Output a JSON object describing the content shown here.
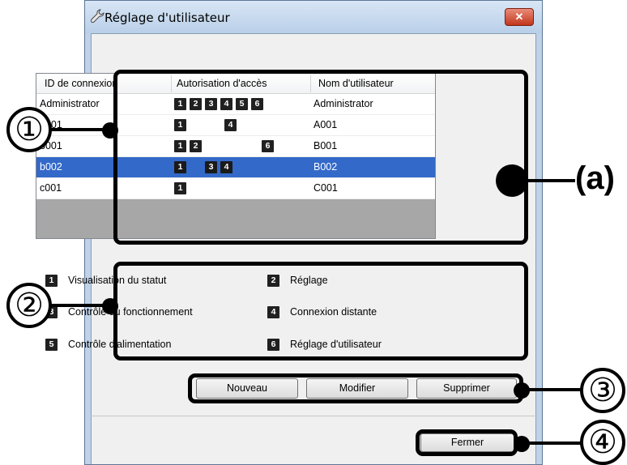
{
  "window": {
    "title": "Réglage d'utilisateur",
    "close_glyph": "✕"
  },
  "table": {
    "headers": [
      "ID de connexion",
      "Autorisation d'accès",
      "Nom d'utilisateur"
    ],
    "rows": [
      {
        "id": "Administrator",
        "name": "Administrator",
        "perms": [
          "1",
          "2",
          "3",
          "4",
          "5",
          "6"
        ],
        "selected": false
      },
      {
        "id": "a001",
        "name": "A001",
        "perms": [
          "1",
          "4"
        ],
        "selected": false
      },
      {
        "id": "b001",
        "name": "B001",
        "perms": [
          "1",
          "2",
          "6"
        ],
        "selected": false
      },
      {
        "id": "b002",
        "name": "B002",
        "perms": [
          "1",
          "3",
          "4"
        ],
        "selected": true
      },
      {
        "id": "c001",
        "name": "C001",
        "perms": [
          "1"
        ],
        "selected": false
      }
    ]
  },
  "legend": [
    {
      "num": "1",
      "text": "Visualisation du statut"
    },
    {
      "num": "2",
      "text": "Réglage"
    },
    {
      "num": "3",
      "text": "Contrôle du fonctionnement"
    },
    {
      "num": "4",
      "text": "Connexion distante"
    },
    {
      "num": "5",
      "text": "Contrôle d'alimentation"
    },
    {
      "num": "6",
      "text": "Réglage d'utilisateur"
    }
  ],
  "buttons": {
    "new": "Nouveau",
    "edit": "Modifier",
    "delete": "Supprimer",
    "close": "Fermer"
  },
  "annotations": {
    "c1": "①",
    "c2": "②",
    "c3": "③",
    "c4": "④",
    "a_label": "(a)"
  },
  "icons": {
    "title": "wrench-icon"
  },
  "colors": {
    "selection": "#3369c9",
    "perm_box": "#202020",
    "close": "#c2361c"
  }
}
